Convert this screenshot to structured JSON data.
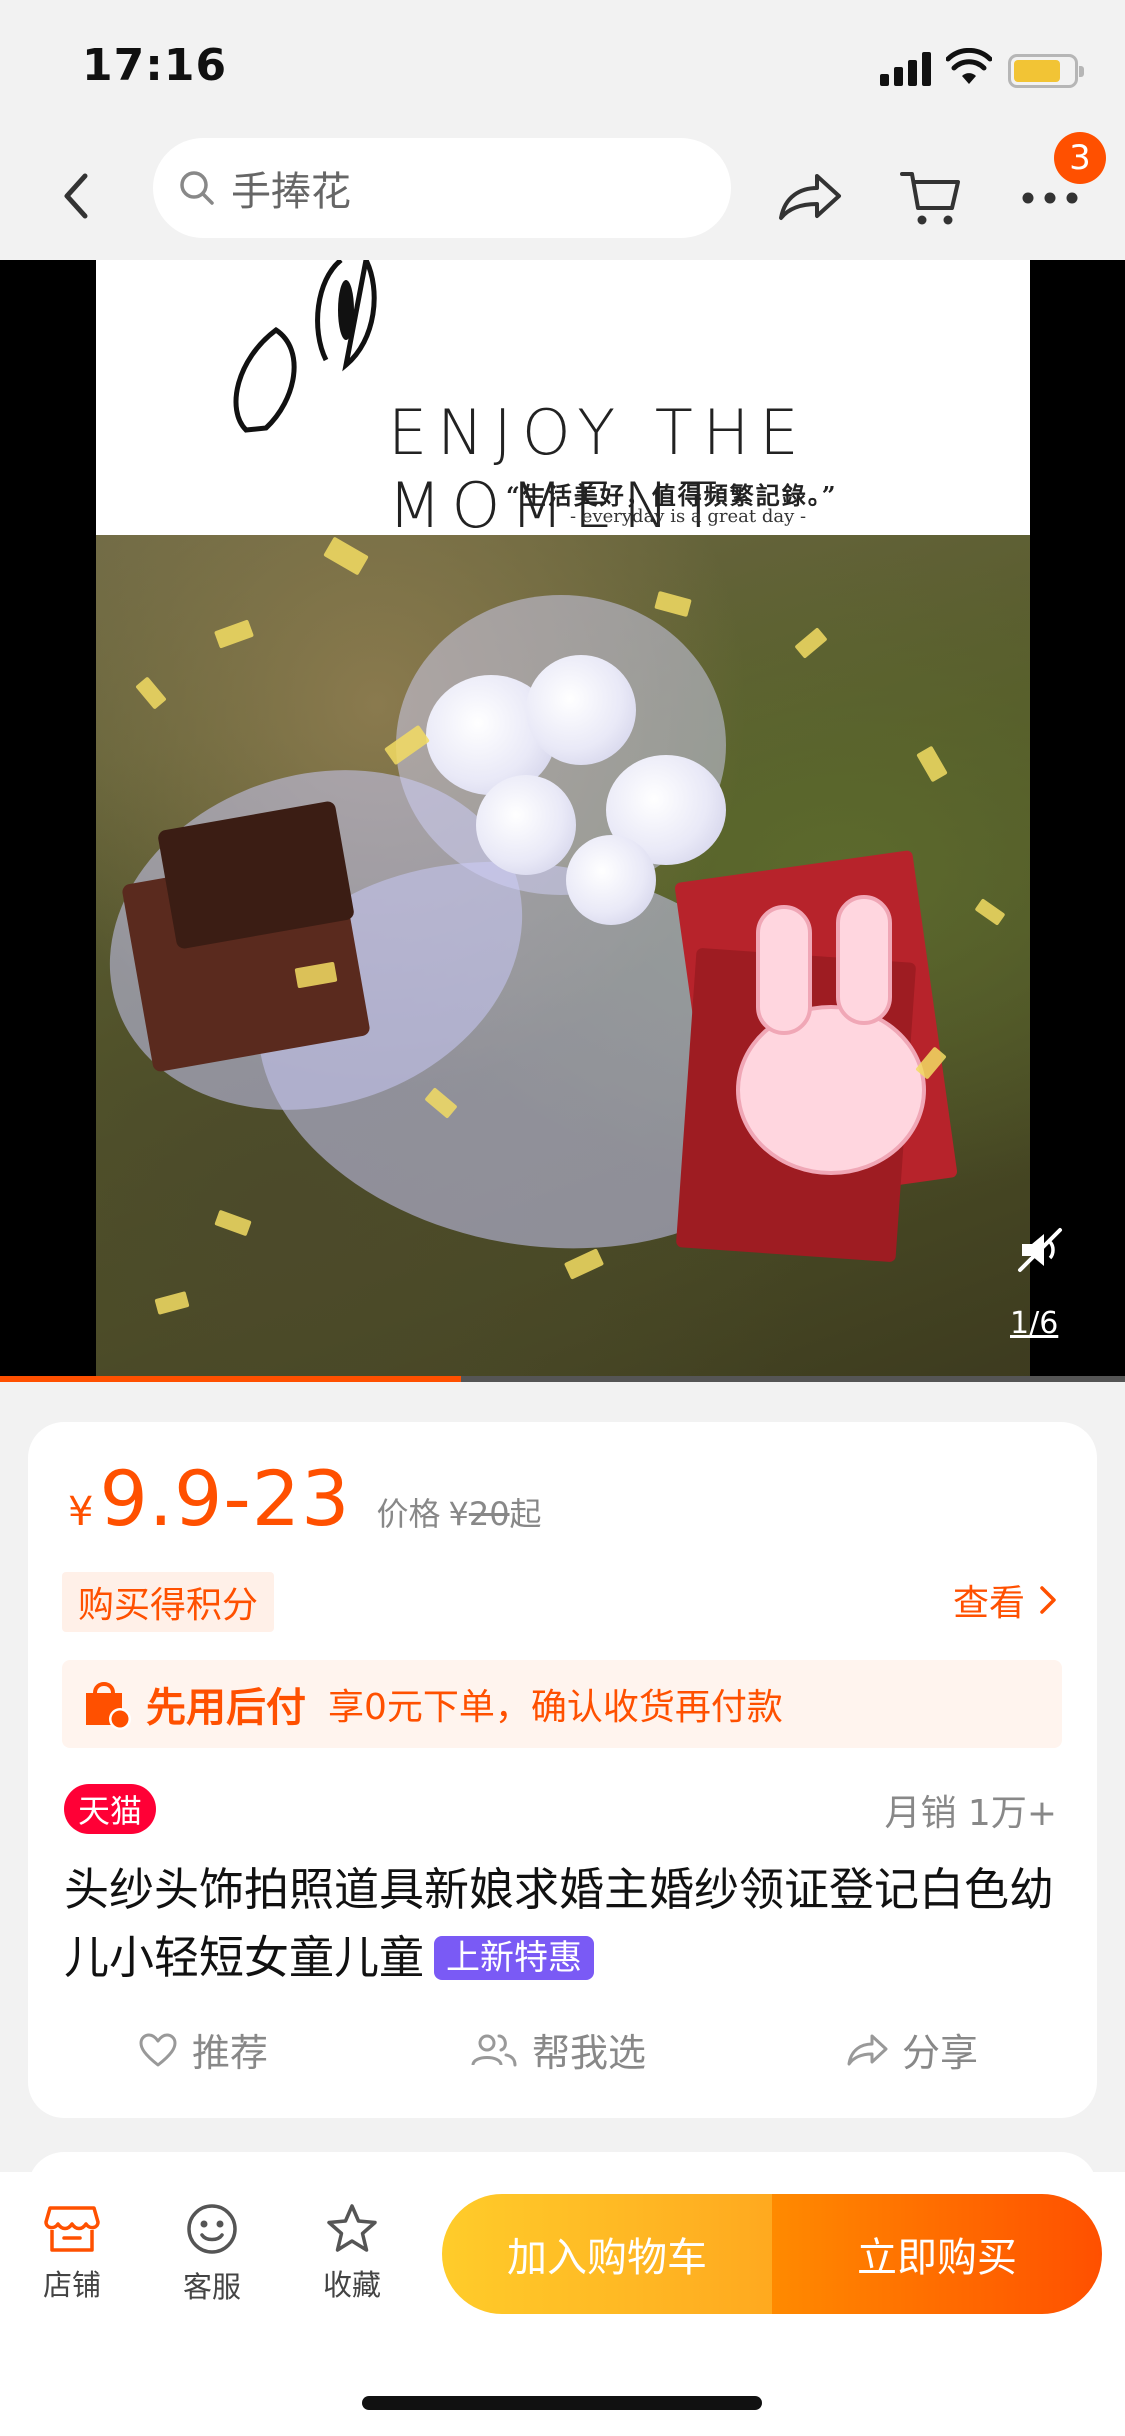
{
  "status_bar": {
    "time": "17:16"
  },
  "nav": {
    "search_placeholder": "手捧花",
    "cart_badge": "3"
  },
  "media": {
    "headline": "ENJOY THE MOMENT",
    "quote": "“生活美好，值得頻繁記錄。”",
    "quote_sub": "- everyday is a great day -",
    "page_indicator": "1/6",
    "progress": 0.41
  },
  "product": {
    "price_yen": "¥",
    "price": "9.9-23",
    "orig_label": "价格",
    "orig_yen": "¥",
    "orig_price": "20",
    "orig_suffix": "起",
    "points_tag": "购买得积分",
    "view_link": "查看",
    "paylater_title": "先用后付",
    "paylater_desc": "享0元下单，确认收货再付款",
    "store_badge": "天猫",
    "monthly_sales": "月销 1万+",
    "title": "头纱头饰拍照道具新娘求婚主婚纱领证登记白色幼儿小轻短女童儿童",
    "new_tag": "上新特惠",
    "actions": {
      "recommend": "推荐",
      "help_choose": "帮我选",
      "share": "分享"
    }
  },
  "bottom_bar": {
    "store": "店铺",
    "service": "客服",
    "favorite": "收藏",
    "add_to_cart": "加入购物车",
    "buy_now": "立即购买"
  },
  "colors": {
    "accent": "#ff5000",
    "tmall": "#ff0036",
    "new_tag": "#7a5af5",
    "cart_button": "#ffb31f",
    "buy_button": "#ff6a00"
  }
}
